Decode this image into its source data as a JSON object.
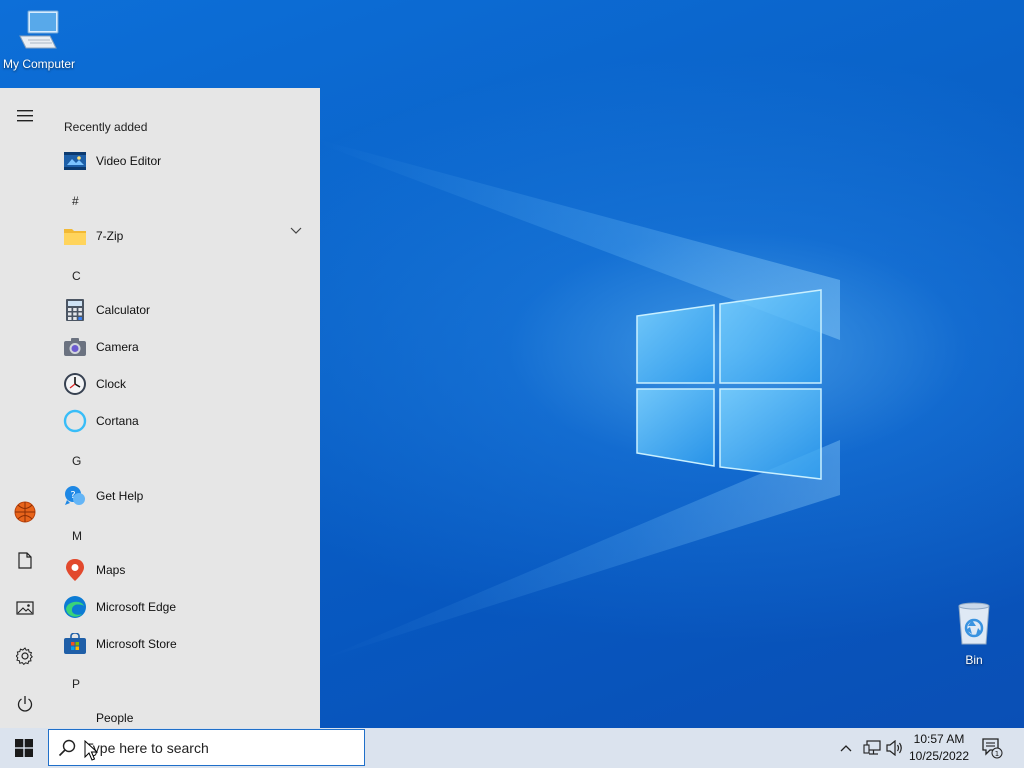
{
  "desktop": {
    "icons": [
      {
        "label": "My Computer",
        "icon": "computer-icon"
      },
      {
        "label": "Bin",
        "icon": "recycle-bin-icon"
      }
    ]
  },
  "start_menu": {
    "recently_added_label": "Recently added",
    "recent_apps": [
      {
        "name": "Video Editor",
        "icon": "video-editor-icon"
      }
    ],
    "sections": [
      {
        "letter": "#",
        "apps": [
          {
            "name": "7-Zip",
            "icon": "folder-icon",
            "expandable": true
          }
        ]
      },
      {
        "letter": "C",
        "apps": [
          {
            "name": "Calculator",
            "icon": "calculator-icon"
          },
          {
            "name": "Camera",
            "icon": "camera-icon"
          },
          {
            "name": "Clock",
            "icon": "clock-icon"
          },
          {
            "name": "Cortana",
            "icon": "cortana-icon"
          }
        ]
      },
      {
        "letter": "G",
        "apps": [
          {
            "name": "Get Help",
            "icon": "get-help-icon"
          }
        ]
      },
      {
        "letter": "M",
        "apps": [
          {
            "name": "Maps",
            "icon": "maps-icon"
          },
          {
            "name": "Microsoft Edge",
            "icon": "edge-icon"
          },
          {
            "name": "Microsoft Store",
            "icon": "store-icon"
          }
        ]
      },
      {
        "letter": "P",
        "apps": [
          {
            "name": "People",
            "icon": "people-icon"
          }
        ]
      }
    ],
    "rail": [
      "hamburger-menu-icon",
      "user-avatar-icon",
      "documents-icon",
      "pictures-icon",
      "settings-icon",
      "power-icon"
    ]
  },
  "taskbar": {
    "search_placeholder": "Type here to search",
    "time": "10:57 AM",
    "date": "10/25/2022",
    "notification_count": "1",
    "tray_icons": [
      "chevron-up-icon",
      "network-icon",
      "volume-icon"
    ]
  },
  "colors": {
    "desktop_blue": "#0a63c9",
    "start_bg": "#e6e6e6",
    "taskbar_bg": "#dbe3ee",
    "search_border": "#1f6fc9"
  }
}
